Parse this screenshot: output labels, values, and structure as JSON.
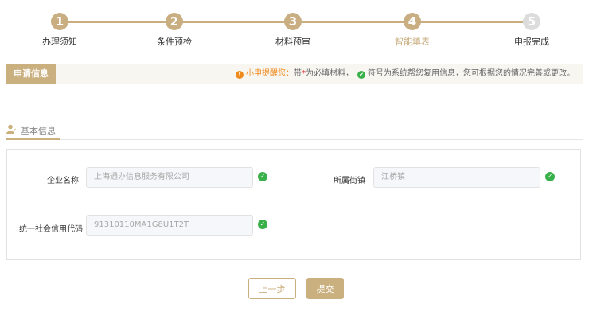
{
  "stepper": {
    "steps": [
      {
        "number": "1",
        "label": "办理须知",
        "state": "done"
      },
      {
        "number": "2",
        "label": "条件预检",
        "state": "done"
      },
      {
        "number": "3",
        "label": "材料预审",
        "state": "done"
      },
      {
        "number": "4",
        "label": "智能填表",
        "state": "active"
      },
      {
        "number": "5",
        "label": "申报完成",
        "state": "pending"
      }
    ]
  },
  "info_bar": {
    "tab_label": "申请信息",
    "hint_prefix": "小申提醒您：",
    "hint_part1": "带",
    "hint_star": "*",
    "hint_part2": "为必填材料，",
    "hint_part3": "符号为系统帮您复用信息，您可根据您的情况完善或更改。"
  },
  "section": {
    "title": "基本信息"
  },
  "form": {
    "company_name_label": "企业名称",
    "company_name_value": "上海通办信息服务有限公司",
    "street_label": "所属街镇",
    "street_value": "江桥镇",
    "credit_code_label": "统一社会信用代码",
    "credit_code_value": "91310110MA1G8U1T2T"
  },
  "buttons": {
    "prev_label": "上一步",
    "submit_label": "提交"
  },
  "colors": {
    "accent": "#cbb07f",
    "success": "#3ab04a",
    "warning": "#f08a1c"
  }
}
